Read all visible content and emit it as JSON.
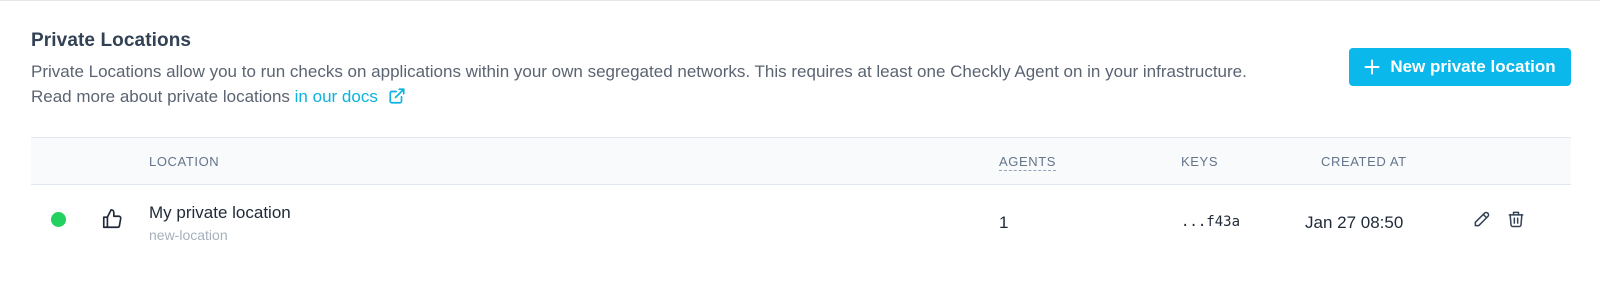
{
  "header": {
    "title": "Private Locations",
    "description_text": "Private Locations allow you to run checks on applications within your own segregated networks. This requires at least one Checkly Agent on in your infrastructure. Read more about private locations ",
    "docs_link_label": "in our docs",
    "new_button_label": "New private location"
  },
  "table": {
    "columns": {
      "location": "LOCATION",
      "agents": "AGENTS",
      "keys": "KEYS",
      "created_at": "CREATED AT"
    },
    "rows": [
      {
        "status": "online",
        "status_color": "#22d160",
        "health_icon": "thumbs-up-icon",
        "name": "My private location",
        "slug": "new-location",
        "agents": "1",
        "keys": "...f43a",
        "created_at": "Jan 27 08:50"
      }
    ]
  },
  "colors": {
    "accent": "#0ab8ec",
    "link": "#0ab3e0"
  }
}
